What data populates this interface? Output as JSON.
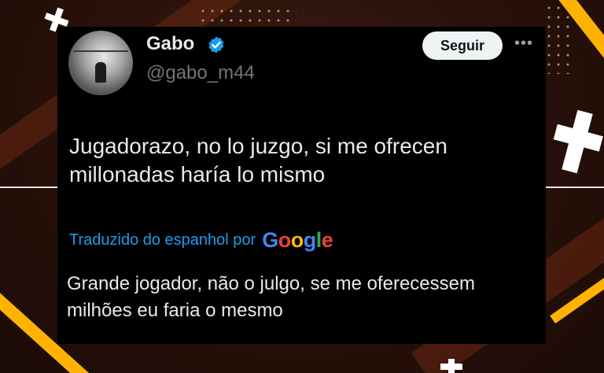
{
  "tweet": {
    "display_name": "Gabo",
    "handle": "@gabo_m44",
    "follow_label": "Seguir",
    "more_label": "•••",
    "text": "Jugadorazo, no lo juzgo, si me ofrecen millonadas haría lo mismo",
    "translated_label": "Traduzido do espanhol por",
    "translator_brand": [
      "G",
      "o",
      "o",
      "g",
      "l",
      "e"
    ],
    "translation": "Grande jogador, não o julgo, se me oferecessem milhões eu faria o mesmo"
  },
  "colors": {
    "accent_blue": "#1d9bf0",
    "background": "#2a120a",
    "stripe_yellow": "#ffb300",
    "card": "#000000"
  },
  "icons": [
    "verified-badge-icon",
    "more-options-icon",
    "plus-decoration-icon"
  ]
}
